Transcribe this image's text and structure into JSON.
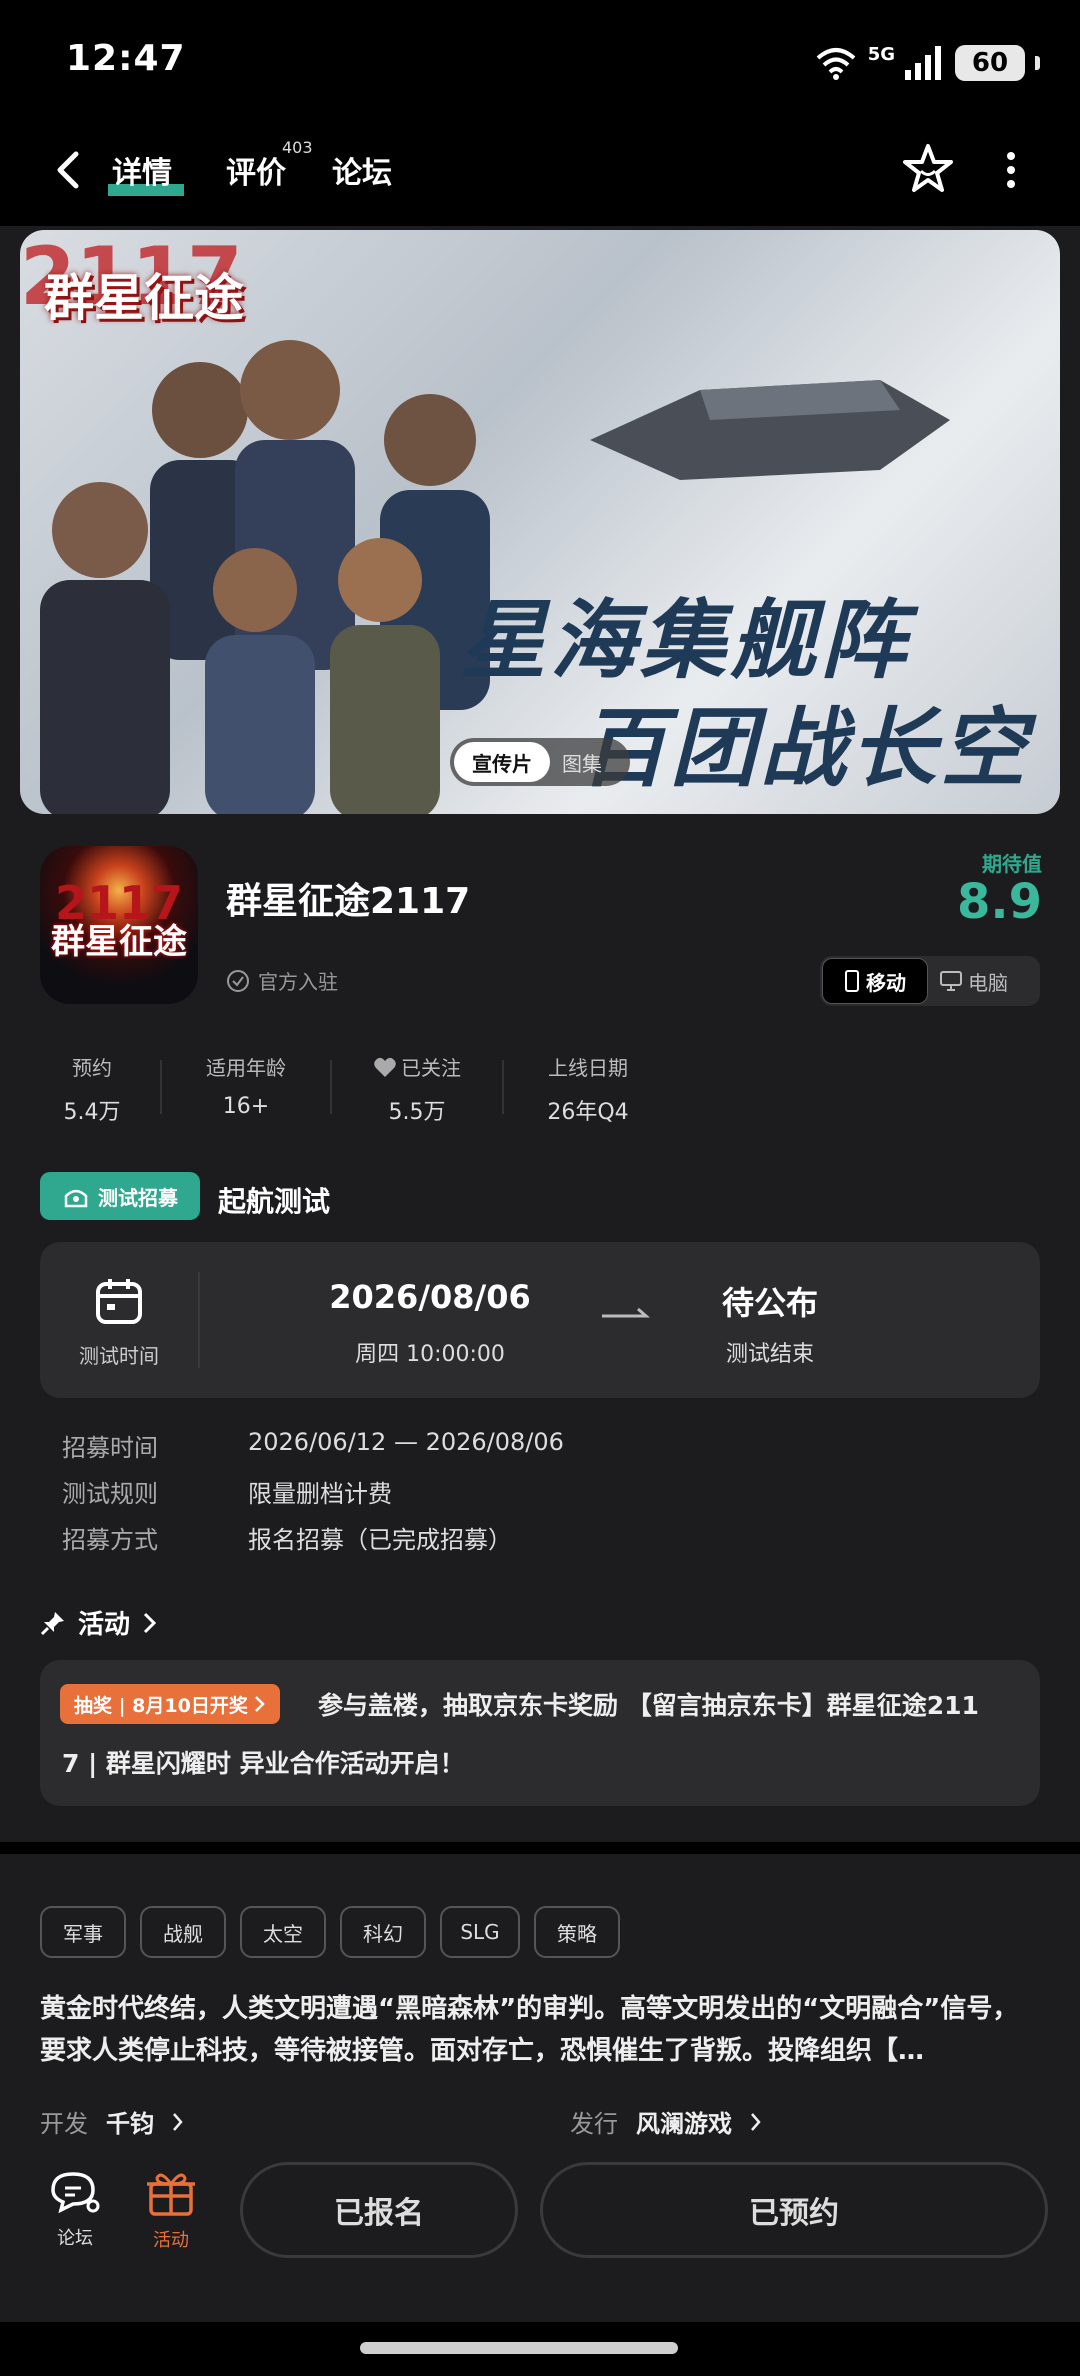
{
  "status": {
    "time": "12:47",
    "network": "5G",
    "battery": "60"
  },
  "nav": {
    "tabs": [
      {
        "label": "详情"
      },
      {
        "label": "评价",
        "badge": "403"
      },
      {
        "label": "论坛"
      }
    ]
  },
  "banner": {
    "logo": "群星征途",
    "logo_number": "2117",
    "slogan_line1": "星海集舰阵",
    "slogan_line2": "百团战长空",
    "media_tabs": [
      "宣传片",
      "图集"
    ]
  },
  "game": {
    "icon_text": "群星征途",
    "icon_number": "2117",
    "title": "群星征途2117",
    "official": "官方入驻",
    "score_label": "期待值",
    "score": "8.9",
    "platforms": [
      "移动",
      "电脑"
    ]
  },
  "stats": [
    {
      "label": "预约",
      "value": "5.4万"
    },
    {
      "label": "适用年龄",
      "value": "16+"
    },
    {
      "label": "已关注",
      "value": "5.5万"
    },
    {
      "label": "上线日期",
      "value": "26年Q4"
    }
  ],
  "test": {
    "badge": "测试招募",
    "title": "起航测试",
    "time_label": "测试时间",
    "start_date": "2026/08/06",
    "start_sub": "周四  10:00:00",
    "end_date": "待公布",
    "end_sub": "测试结束",
    "info": [
      {
        "key": "招募时间",
        "value": "2026/06/12 — 2026/08/06"
      },
      {
        "key": "测试规则",
        "value": "限量删档计费"
      },
      {
        "key": "招募方式",
        "value": "报名招募（已完成招募）"
      }
    ]
  },
  "activity": {
    "heading": "活动",
    "tag": "抽奖 | 8月10日开奖",
    "line1": "参与盖楼，抽取京东卡奖励 【留言抽京东卡】群星征途211",
    "line2": "7 | 群星闪耀时 异业合作活动开启！"
  },
  "tags": [
    "军事",
    "战舰",
    "太空",
    "科幻",
    "SLG",
    "策略"
  ],
  "description": "黄金时代终结，人类文明遭遇“黑暗森林”的审判。高等文明发出的“文明融合”信号，要求人类停止科技，等待被接管。面对存亡，恐惧催生了背叛。投降组织【…",
  "developer": {
    "key": "开发",
    "value": "千钧"
  },
  "publisher": {
    "key": "发行",
    "value": "风澜游戏"
  },
  "bottom": {
    "forum_label": "论坛",
    "activity_label": "活动",
    "btn_registered": "已报名",
    "btn_reserved": "已预约"
  },
  "colors": {
    "accent": "#2fa88f",
    "orange": "#e8703a",
    "background": "#1c1c1e"
  }
}
